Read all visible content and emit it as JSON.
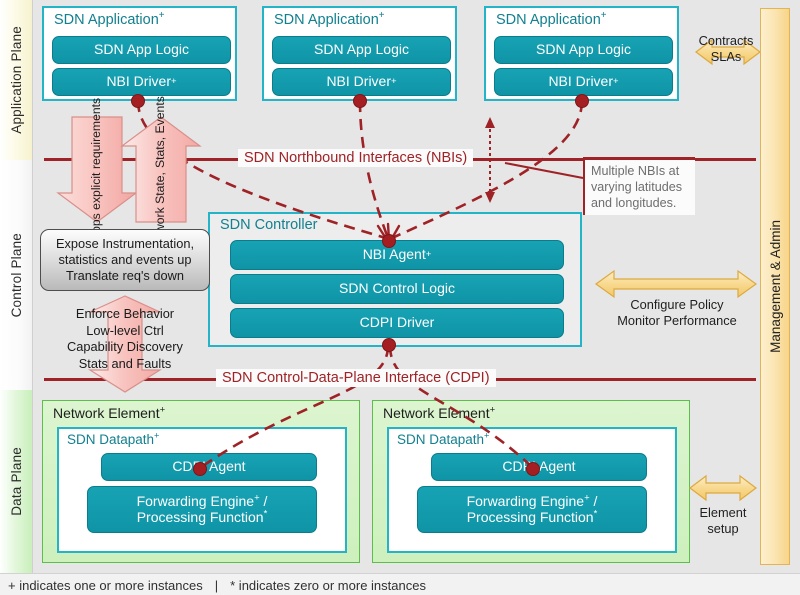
{
  "planes": [
    {
      "id": "application",
      "label": "Application Plane"
    },
    {
      "id": "control",
      "label": "Control Plane"
    },
    {
      "id": "data",
      "label": "Data Plane"
    }
  ],
  "application_plane": {
    "apps": [
      {
        "title": "SDN Application",
        "title_sup": "+",
        "logic": "SDN App Logic",
        "driver": "NBI Driver",
        "driver_sup": "+"
      },
      {
        "title": "SDN Application",
        "title_sup": "+",
        "logic": "SDN App Logic",
        "driver": "NBI Driver",
        "driver_sup": "+"
      },
      {
        "title": "SDN Application",
        "title_sup": "+",
        "logic": "SDN App Logic",
        "driver": "NBI Driver",
        "driver_sup": "+"
      }
    ]
  },
  "control_plane": {
    "controller_title": "SDN Controller",
    "layers": [
      {
        "label": "NBI Agent",
        "sup": "+"
      },
      {
        "label": "SDN Control Logic",
        "sup": ""
      },
      {
        "label": "CDPI Driver",
        "sup": ""
      }
    ]
  },
  "data_plane": {
    "elements": [
      {
        "title": "Network Element",
        "title_sup": "+",
        "datapath": "SDN Datapath",
        "datapath_sup": "+",
        "agent": "CDPI Agent",
        "forwarding_line1": "Forwarding Engine",
        "forwarding_sup": "+",
        "forwarding_line1_tail": " /",
        "forwarding_line2": "Processing Function",
        "forwarding_line2_sup": "*"
      },
      {
        "title": "Network Element",
        "title_sup": "+",
        "datapath": "SDN Datapath",
        "datapath_sup": "+",
        "agent": "CDPI Agent",
        "forwarding_line1": "Forwarding Engine",
        "forwarding_sup": "+",
        "forwarding_line1_tail": " /",
        "forwarding_line2": "Processing Function",
        "forwarding_line2_sup": "*"
      }
    ]
  },
  "interfaces": {
    "nbi_label": "SDN Northbound Interfaces (NBIs)",
    "cdpi_label": "SDN Control-Data-Plane Interface (CDPI)"
  },
  "arrows": {
    "apps_requirements": "Apps explicit\nrequirements",
    "apps_requirements_l1": "Apps explicit",
    "apps_requirements_l2": "requirements",
    "network_state_l1": "Network State,",
    "network_state_l2": "Stats, Events",
    "control_to_data_l1": "Enforce Behavior",
    "control_to_data_l2": "Low-level Ctrl",
    "control_to_data_l3": "Capability Discovery",
    "control_to_data_l4": "Stats and Faults"
  },
  "notes": {
    "gray_note_l1": "Expose Instrumentation,",
    "gray_note_l2": "statistics and events up",
    "gray_note_l3": "Translate req's down",
    "callout_l1": "Multiple NBIs at",
    "callout_l2": "varying latitudes",
    "callout_l3": "and longitudes."
  },
  "management": {
    "panel_label": "Management & Admin",
    "contracts_l1": "Contracts",
    "contracts_l2": "SLAs",
    "configure_l1": "Configure Policy",
    "configure_l2": "Monitor Performance",
    "element_l1": "Element",
    "element_l2": "setup"
  },
  "footer": {
    "plus_note": "+ indicates one or more instances",
    "separator": "|",
    "star_note": "* indicates zero or more instances"
  },
  "colors": {
    "teal": "#169aad",
    "teal_border": "#23b4c8",
    "interface_red": "#9e2226",
    "green": "#5cbf4a",
    "pink": "#f7b9b5",
    "amber": "#f7d487",
    "background": "#e6e6e6"
  }
}
